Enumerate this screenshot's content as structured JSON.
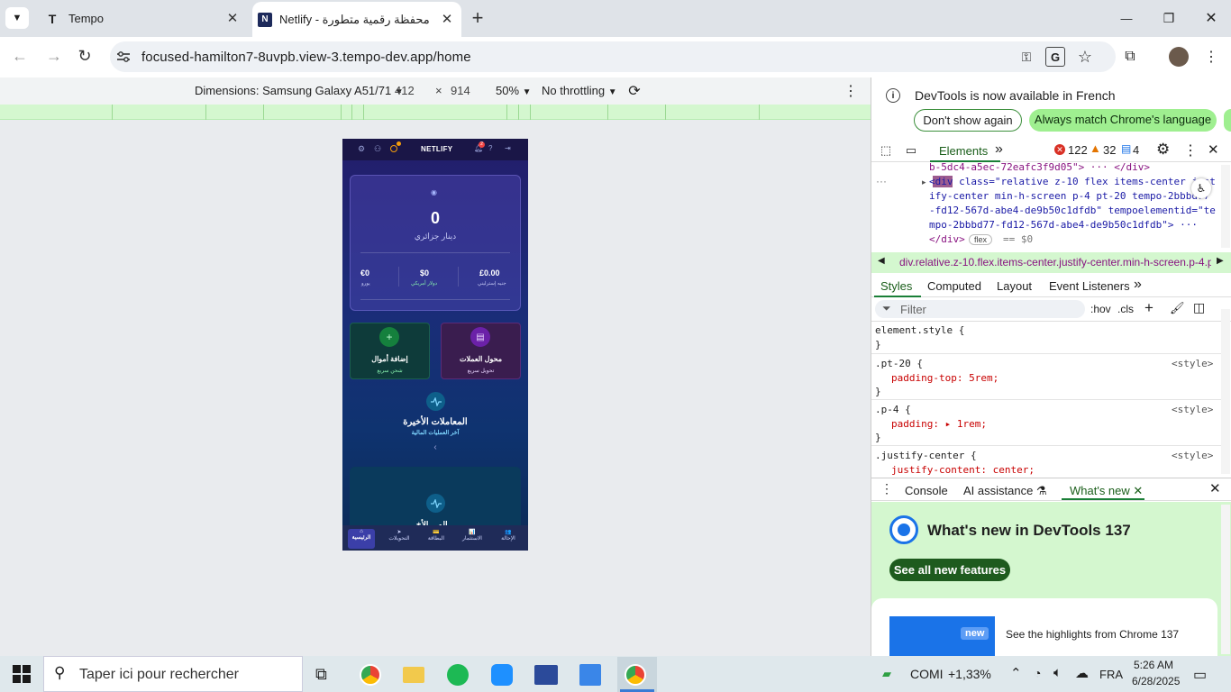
{
  "tabs": [
    {
      "title": "Tempo",
      "close": "✕"
    },
    {
      "title": "Netlify - محفظة رقمية متطورة",
      "close": "✕"
    }
  ],
  "new_tab": "+",
  "window_controls": {
    "minimize": "—",
    "maximize": "❐",
    "close": "✕"
  },
  "address": {
    "url": "focused-hamilton7-8uvpb.view-3.tempo-dev.app/home"
  },
  "device_toolbar": {
    "dimensions": "Dimensions: Samsung Galaxy A51/71",
    "width": "412",
    "times": "×",
    "height": "914",
    "zoom": "50%",
    "throttling": "No throttling"
  },
  "app": {
    "brand": "NETLIFY",
    "notification_count": "2",
    "balance": "0",
    "balance_currency": "دينار جزائري",
    "currencies": [
      {
        "value": "£0.00",
        "label": "جنيه إسترليني"
      },
      {
        "value": "$0",
        "label": "دولار أمريكي"
      },
      {
        "value": "€0",
        "label": "يورو"
      }
    ],
    "actions": [
      {
        "title": "محول العملات",
        "subtitle": "تحويل سريع",
        "icon": "▤"
      },
      {
        "title": "إضافة أموال",
        "subtitle": "شحن سريع",
        "icon": "+"
      }
    ],
    "recent": {
      "title": "المعاملات الأخيرة",
      "subtitle": "آخر العمليات المالية",
      "chevron": "‹"
    },
    "lower_card_title": "الم... الأخ...",
    "nav": [
      {
        "label": "الإحالة",
        "icon": "👥"
      },
      {
        "label": "الاستثمار",
        "icon": "📊"
      },
      {
        "label": "البطاقة",
        "icon": "💳"
      },
      {
        "label": "التحويلات",
        "icon": "➤"
      },
      {
        "label": "الرئيسية",
        "icon": "⌂"
      }
    ],
    "colors": {
      "primary": "#2b2f8f",
      "accent_green": "#16a34a",
      "accent_purple": "#7e22ce"
    }
  },
  "devtools": {
    "info_text": "DevTools is now available in French",
    "dont_show": "Don't show again",
    "match_lang": "Always match Chrome's language",
    "tab_elements": "Elements",
    "more_tabs": "»",
    "errors": "122",
    "warnings": "32",
    "messages": "4",
    "dom_lines": [
      "b-5dc4-a5ec-72eafc3f9d05\"> ··· </div>",
      "<div class=\"relative z-10 flex items-center just",
      "ify-center min-h-screen p-4 pt-20 tempo-2bbbd77",
      "-fd12-567d-abe4-de9b50c1dfdb\" tempoelementid=\"te",
      "mpo-2bbbd77-fd12-567d-abe4-de9b50c1dfdb\"> ···",
      "</div>"
    ],
    "flex_badge": "flex",
    "eq_dollar": "== $0",
    "breadcrumb": "div.relative.z-10.flex.items-center.justify-center.min-h-screen.p-4.p",
    "sub_tabs": [
      "Styles",
      "Computed",
      "Layout",
      "Event Listeners"
    ],
    "filter_placeholder": "Filter",
    "hov": ":hov",
    "cls": ".cls",
    "rules": [
      {
        "selector": "element.style {",
        "decl": "",
        "close": "}",
        "source": ""
      },
      {
        "selector": ".pt-20 {",
        "decl": "padding-top: 5rem;",
        "close": "}",
        "source": "<style>"
      },
      {
        "selector": ".p-4 {",
        "decl": "padding: ▸ 1rem;",
        "close": "}",
        "source": "<style>"
      },
      {
        "selector": ".justify-center {",
        "decl": "justify-content: center;",
        "close": "",
        "source": "<style>"
      }
    ],
    "drawer_tabs": [
      "Console",
      "AI assistance",
      "What's new"
    ],
    "whats_new_title": "What's new in DevTools 137",
    "see_all": "See all new features",
    "new_badge": "new",
    "highlights": "See the highlights from Chrome 137"
  },
  "taskbar": {
    "search_placeholder": "Taper ici pour rechercher",
    "stock": "COMI",
    "stock_change": "+1,33%",
    "lang": "FRA",
    "time": "5:26 AM",
    "date": "6/28/2025"
  }
}
